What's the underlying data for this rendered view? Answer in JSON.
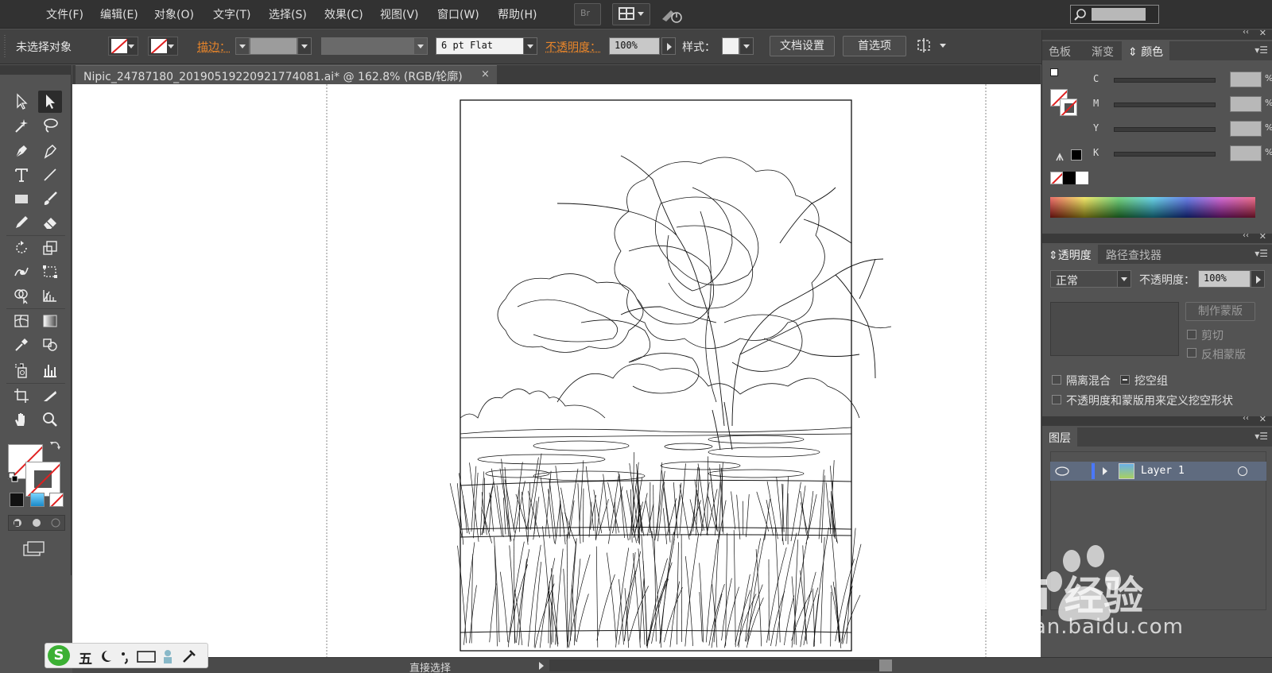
{
  "menubar": {
    "items": [
      "文件(F)",
      "编辑(E)",
      "对象(O)",
      "文字(T)",
      "选择(S)",
      "效果(C)",
      "视图(V)",
      "窗口(W)",
      "帮助(H)"
    ],
    "br_label": "Br"
  },
  "controlbar": {
    "selection_status": "未选择对象",
    "stroke_label": "描边：",
    "stroke_profile": "6 pt Flat",
    "opacity_label": "不透明度：",
    "opacity_value": "100%",
    "style_label": "样式：",
    "doc_setup_button": "文档设置",
    "prefs_button": "首选项"
  },
  "document": {
    "tab_title": "Nipic_24787180_20190519220921774081.ai* @ 162.8% (RGB/轮廓)",
    "close_glyph": "×"
  },
  "statusbar": {
    "tool_name": "直接选择",
    "ime_logo": "S",
    "ime_mode": "五"
  },
  "color_panel": {
    "tabs": [
      "色板",
      "渐变",
      "颜色"
    ],
    "active_tab": "颜色",
    "channels": [
      {
        "label": "C",
        "unit": "%"
      },
      {
        "label": "M",
        "unit": "%"
      },
      {
        "label": "Y",
        "unit": "%"
      },
      {
        "label": "K",
        "unit": "%"
      }
    ]
  },
  "transparency_panel": {
    "tabs": [
      "透明度",
      "路径查找器"
    ],
    "blend_mode": "正常",
    "opacity_label": "不透明度：",
    "opacity_value": "100%",
    "make_mask_button": "制作蒙版",
    "clip_label": "剪切",
    "invert_mask_label": "反相蒙版",
    "isolate_blending_label": "隔离混合",
    "knockout_group_label": "挖空组",
    "opacity_mask_label": "不透明度和蒙版用来定义挖空形状"
  },
  "layers_panel": {
    "tab": "图层",
    "layers": [
      {
        "name": "Layer 1"
      }
    ]
  },
  "watermark": {
    "brand": "Bai 经验",
    "url": "jingyan.baidu.com"
  },
  "colors": {
    "app_bg": "#535353",
    "menubar_bg": "#323232",
    "accent_orange": "#e8852a",
    "layer_highlight": "#5f6b7f"
  }
}
